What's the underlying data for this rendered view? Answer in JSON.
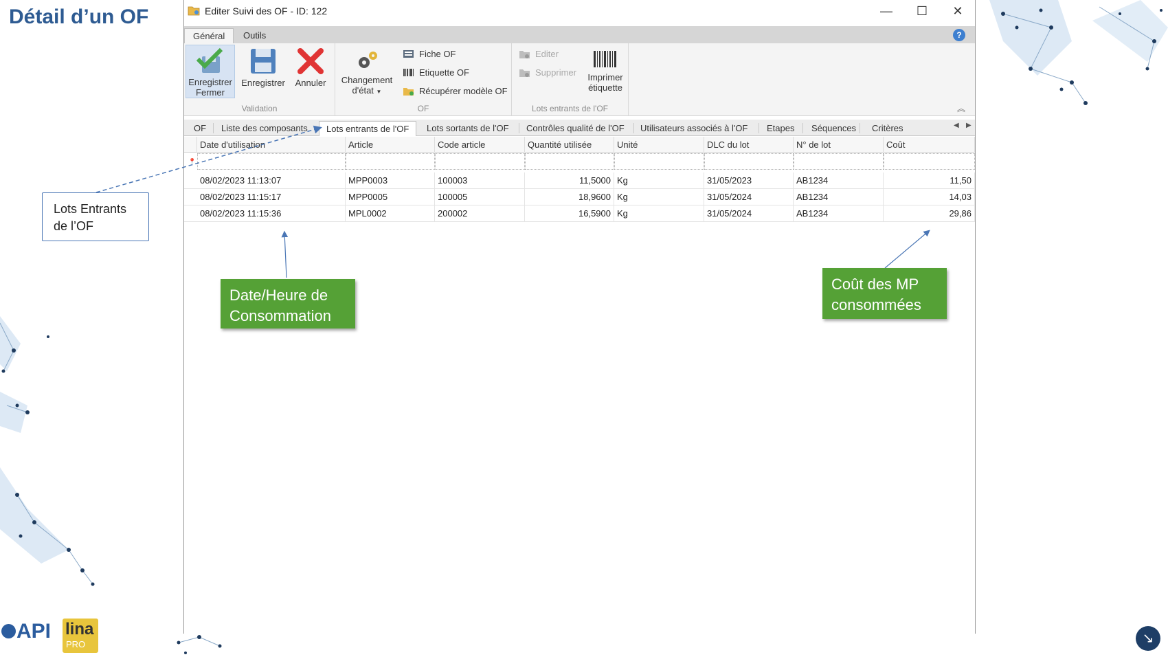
{
  "slide": {
    "title": "Détail d’un OF"
  },
  "window": {
    "title": "Editer Suivi des OF - ID: 122",
    "controls": {
      "minimize": "—",
      "maximize": "☐",
      "close": "✕"
    }
  },
  "ribbon_tabs": [
    {
      "label": "Général",
      "active": true
    },
    {
      "label": "Outils",
      "active": false
    }
  ],
  "help_label": "?",
  "ribbon": {
    "validation": {
      "label": "Validation",
      "save_close": {
        "line1": "Enregistrer",
        "line2": "Fermer"
      },
      "save": "Enregistrer",
      "cancel": "Annuler"
    },
    "of": {
      "label": "OF",
      "change_state": {
        "line1": "Changement",
        "line2": "d'état"
      },
      "fiche": "Fiche OF",
      "etiquette": "Etiquette OF",
      "recuperer": "Récupérer modèle OF"
    },
    "lots": {
      "label": "Lots entrants de l'OF",
      "editer": "Editer",
      "supprimer": "Supprimer",
      "imprimer": {
        "line1": "Imprimer",
        "line2": "étiquette"
      }
    }
  },
  "sub_tabs": [
    {
      "label": "OF",
      "active": false
    },
    {
      "label": "Liste des composants",
      "active": false
    },
    {
      "label": "Lots entrants de l'OF",
      "active": true
    },
    {
      "label": "Lots sortants de l'OF",
      "active": false
    },
    {
      "label": "Contrôles qualité de l'OF",
      "active": false
    },
    {
      "label": "Utilisateurs associés à l'OF",
      "active": false
    },
    {
      "label": "Etapes",
      "active": false
    },
    {
      "label": "Séquences",
      "active": false
    },
    {
      "label": "Critères",
      "active": false
    }
  ],
  "grid": {
    "columns": [
      "Date d'utilisation",
      "Article",
      "Code article",
      "Quantité utilisée",
      "Unité",
      "DLC du lot",
      "N° de lot",
      "Coût"
    ],
    "rows": [
      [
        "08/02/2023 11:13:07",
        "MPP0003",
        "100003",
        "11,5000",
        "Kg",
        "31/05/2023",
        "AB1234",
        "11,50"
      ],
      [
        "08/02/2023 11:15:17",
        "MPP0005",
        "100005",
        "18,9600",
        "Kg",
        "31/05/2024",
        "AB1234",
        "14,03"
      ],
      [
        "08/02/2023 11:15:36",
        "MPL0002",
        "200002",
        "16,5900",
        "Kg",
        "31/05/2024",
        "AB1234",
        "29,86"
      ]
    ]
  },
  "callouts": {
    "lots_entrants": {
      "line1": "Lots Entrants",
      "line2": "de l’OF"
    },
    "date_heure": {
      "line1": "Date/Heure de",
      "line2": "Consommation"
    },
    "cout_mp": {
      "line1": "Coût des MP",
      "line2": "consommées"
    }
  },
  "logos": {
    "api": "API",
    "lina": "lina",
    "pro": "PRO"
  },
  "nav_icon": "arrow-down-right-icon",
  "colors": {
    "title_blue": "#2e5b92",
    "callout_green": "#55a136",
    "callout_border": "#4a76b5"
  }
}
